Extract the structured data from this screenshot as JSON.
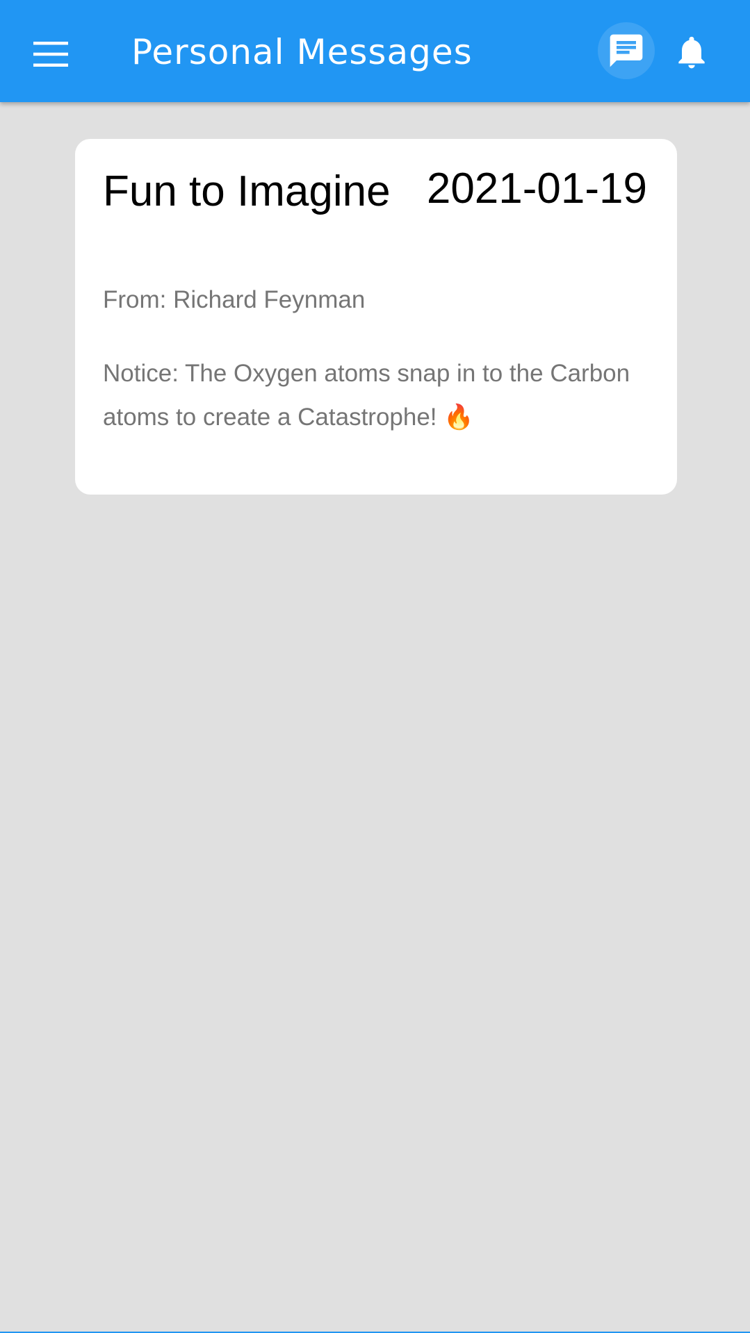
{
  "app_bar": {
    "title": "Personal Messages",
    "menu_icon": "menu-icon",
    "messages_icon": "message-icon",
    "notifications_icon": "bell-icon",
    "color": "#2196f3"
  },
  "message": {
    "subject": "Fun to Imagine",
    "date": "2021-01-19",
    "from": "From: Richard Feynman",
    "body": "Notice: The Oxygen atoms snap in to the Carbon atoms to create a Catastrophe! 🔥"
  }
}
